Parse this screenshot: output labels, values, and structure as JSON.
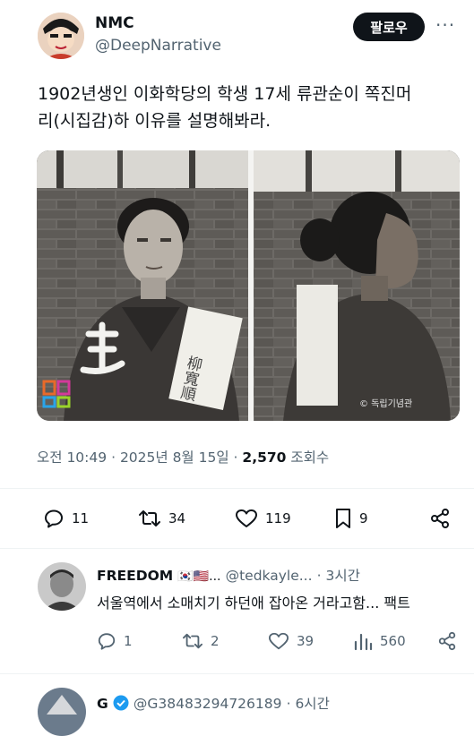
{
  "post": {
    "author_name": "NMC",
    "author_handle": "@DeepNarrative",
    "follow_label": "팔로우",
    "more_label": "···",
    "text_line1": "1902년생인 이화학당의 학생 17세 류관순이 쪽진머",
    "text_line2": "리(시집감)하 이유를 설명해봐라.",
    "photo_watermark": "© 독립기념관",
    "photo_caption_left": "柳寬順",
    "photo_caption_right": "",
    "time": "오전 10:49",
    "dot": "·",
    "date": "2025년 8월 15일",
    "dot2": "·",
    "views": "2,570",
    "views_label": "조회수"
  },
  "actions": {
    "replies": "11",
    "reposts": "34",
    "likes": "119",
    "bookmarks": "9"
  },
  "reply1": {
    "name": "FREEDOM",
    "flags": "🇰🇷🇺🇸...",
    "handle": "@tedkayle...",
    "time": "· 3시간",
    "text": "서울역에서 소매치기 하던애 잡아온 거라고함... 팩트",
    "replies": "1",
    "reposts": "2",
    "likes": "39",
    "views": "560"
  },
  "reply2": {
    "name": "G",
    "handle": "@G38483294726189",
    "time": "· 6시간"
  },
  "colors": {
    "text": "#0f1419",
    "secondary": "#536471",
    "verified": "#1d9bf0"
  }
}
